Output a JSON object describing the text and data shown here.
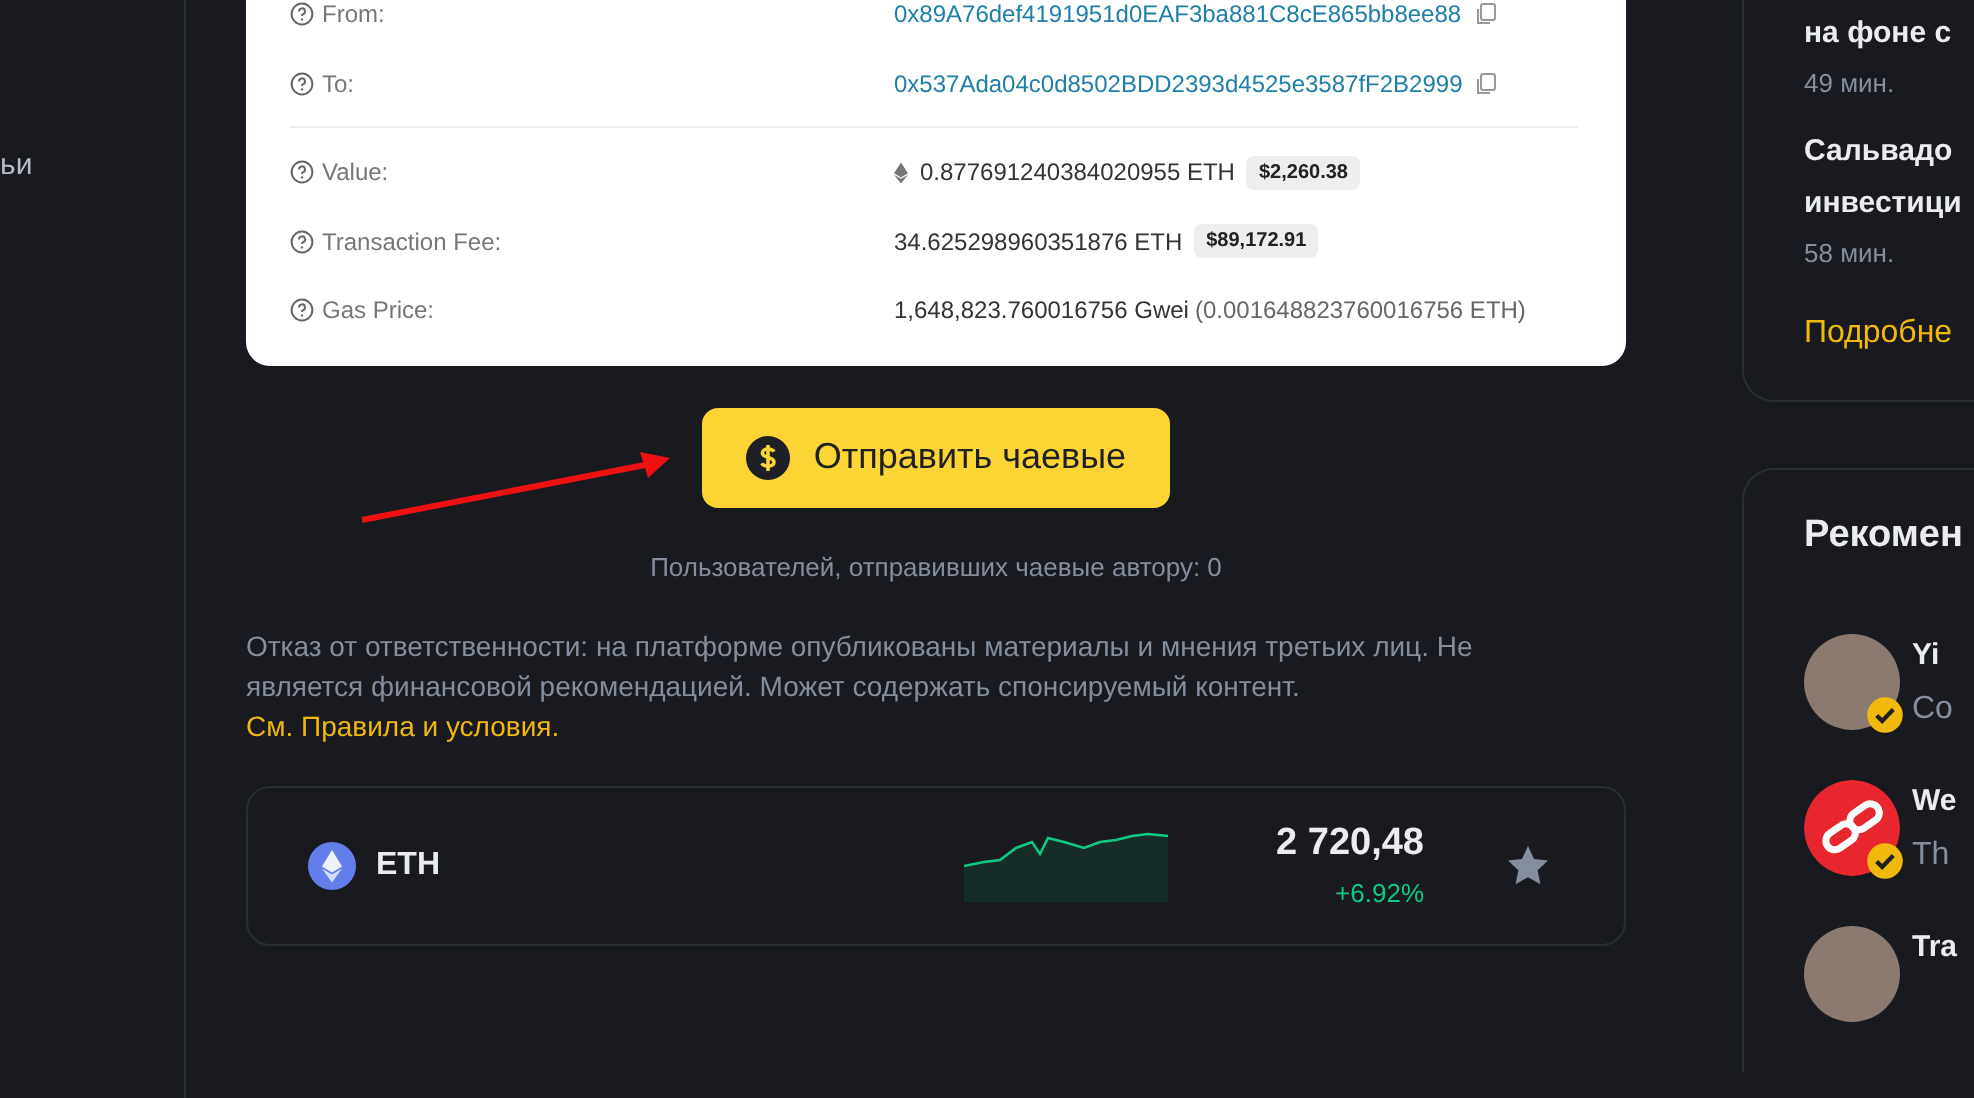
{
  "sidebar": {
    "text": "ьи"
  },
  "transaction": {
    "rows": [
      {
        "kind": "address",
        "label": "From:",
        "value": "0x89A76def4191951d0EAF3ba881C8cE865bb8ee88"
      },
      {
        "kind": "address",
        "label": "To:",
        "value": "0x537Ada04c0d8502BDD2393d4525e3587fF2B2999"
      },
      {
        "kind": "eth",
        "label": "Value:",
        "value": "0.877691240384020955 ETH",
        "usd": "$2,260.38"
      },
      {
        "kind": "amount",
        "label": "Transaction Fee:",
        "value": "34.625298960351876 ETH",
        "usd": "$89,172.91"
      },
      {
        "kind": "gas",
        "label": "Gas Price:",
        "value": "1,648,823.760016756 Gwei",
        "secondary": "(0.001648823760016756 ETH)"
      }
    ]
  },
  "tip_button": {
    "label": "Отправить чаевые"
  },
  "tip_count": "Пользователей, отправивших чаевые автору: 0",
  "disclaimer": {
    "text": "Отказ от ответственности: на платформе опубликованы материалы и мнения третьих лиц. Не является финансовой рекомендацией. Может содержать спонсируемый контент.",
    "link": "См. Правила и условия."
  },
  "asset": {
    "symbol": "ETH",
    "price": "2 720,48",
    "change": "+6.92%",
    "favorite": false
  },
  "news": {
    "items": [
      {
        "title": [
          "на фоне с"
        ],
        "time": "49 мин."
      },
      {
        "title": [
          "Сальвадо",
          "инвестици"
        ],
        "time": "58 мин."
      }
    ],
    "more": "Подробне"
  },
  "recommended": {
    "title": "Рекомен",
    "users": [
      {
        "name": "Yi",
        "subtitle": "Co",
        "kind": "photo",
        "verified": true
      },
      {
        "name": "We",
        "subtitle": "Th",
        "kind": "logo",
        "verified": true
      },
      {
        "name": "Tra",
        "kind": "photo"
      }
    ]
  }
}
